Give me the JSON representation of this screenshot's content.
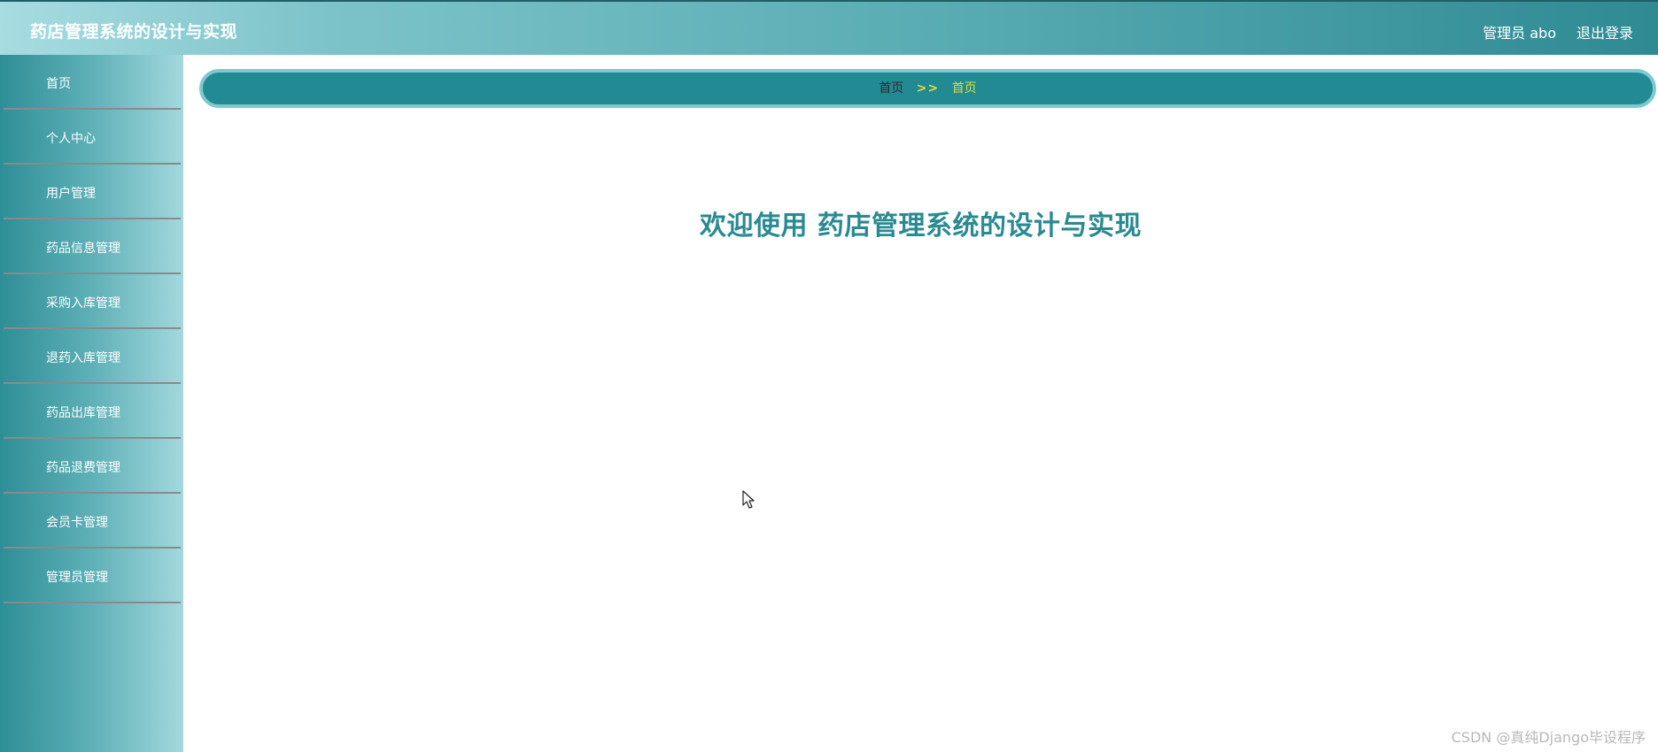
{
  "header": {
    "title": "药店管理系统的设计与实现",
    "user_label": "管理员 abo",
    "logout_label": "退出登录"
  },
  "sidebar": {
    "items": [
      {
        "label": "首页"
      },
      {
        "label": "个人中心"
      },
      {
        "label": "用户管理"
      },
      {
        "label": "药品信息管理"
      },
      {
        "label": "采购入库管理"
      },
      {
        "label": "退药入库管理"
      },
      {
        "label": "药品出库管理"
      },
      {
        "label": "药品退费管理"
      },
      {
        "label": "会员卡管理"
      },
      {
        "label": "管理员管理"
      }
    ]
  },
  "breadcrumb": {
    "home": "首页",
    "separator": ">>",
    "current": "首页"
  },
  "main": {
    "welcome_text": "欢迎使用 药店管理系统的设计与实现"
  },
  "watermark": "CSDN @真纯Django毕设程序",
  "colors": {
    "accent": "#218a92",
    "welcome": "#2a8a92",
    "breadcrumb_current": "#e9d83a"
  }
}
